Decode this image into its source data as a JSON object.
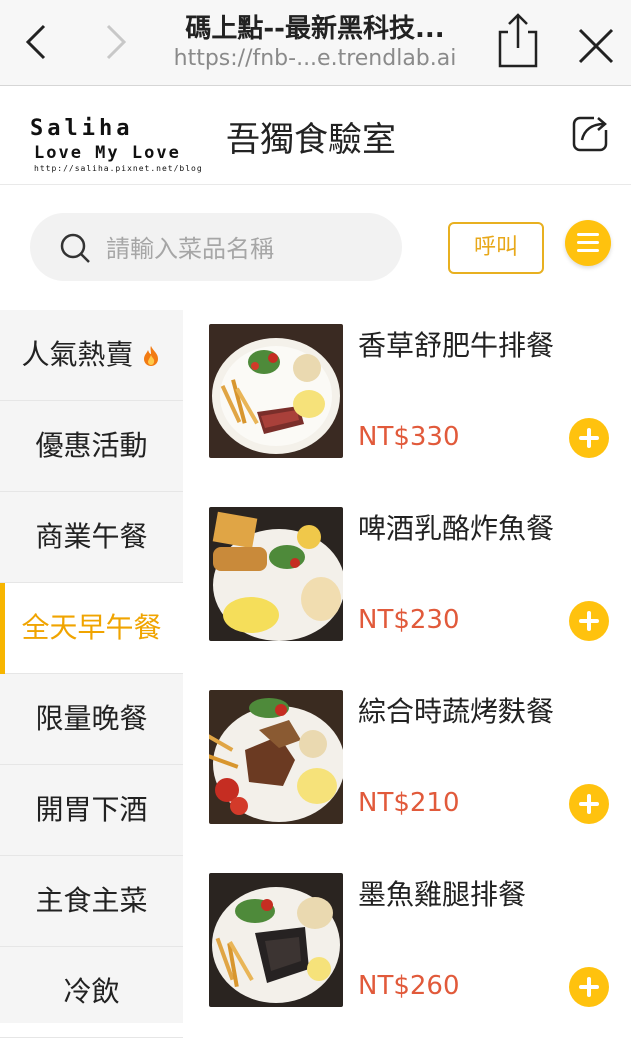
{
  "browser": {
    "title": "碼上點--最新黑科技...",
    "url": "https://fnb-...e.trendlab.ai"
  },
  "header": {
    "logo_line1": "Saliha",
    "logo_line2": "Love My Love",
    "logo_line3": "http://saliha.pixnet.net/blog",
    "store_name": "吾獨食驗室"
  },
  "search": {
    "placeholder": "請輸入菜品名稱",
    "call_label": "呼叫"
  },
  "categories": [
    {
      "label": "人氣熱賣",
      "icon": "fire-icon"
    },
    {
      "label": "優惠活動"
    },
    {
      "label": "商業午餐"
    },
    {
      "label": "全天早午餐",
      "active": true
    },
    {
      "label": "限量晚餐"
    },
    {
      "label": "開胃下酒"
    },
    {
      "label": "主食主菜"
    },
    {
      "label": "冷飲"
    }
  ],
  "products": [
    {
      "name": "香草舒肥牛排餐",
      "price": "NT$330"
    },
    {
      "name": "啤酒乳酪炸魚餐",
      "price": "NT$230"
    },
    {
      "name": "綜合時蔬烤麩餐",
      "price": "NT$210"
    },
    {
      "name": "墨魚雞腿排餐",
      "price": "NT$260"
    }
  ],
  "colors": {
    "accent": "#ffc20e",
    "active_text": "#f0a400",
    "price": "#e15a3b"
  }
}
